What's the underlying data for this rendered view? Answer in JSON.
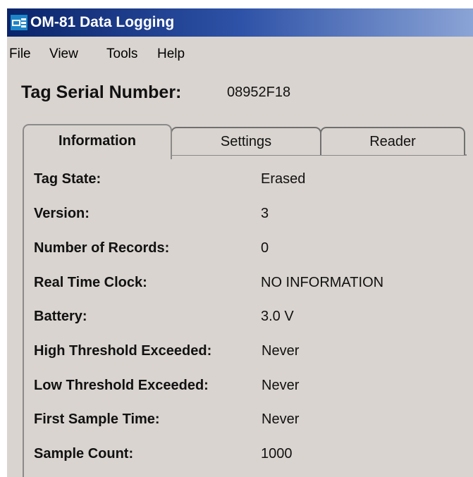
{
  "window": {
    "title": "OM-81 Data Logging",
    "icon": "app-icon"
  },
  "menu": [
    "File",
    "View",
    "Tools",
    "Help"
  ],
  "serial": {
    "label": "Tag Serial Number:",
    "value": "08952F18"
  },
  "tabs": [
    {
      "label": "Information",
      "active": true
    },
    {
      "label": "Settings",
      "active": false
    },
    {
      "label": "Reader",
      "active": false
    }
  ],
  "info_rows": [
    {
      "label": "Tag State:",
      "value": "Erased"
    },
    {
      "label": "Version:",
      "value": "3"
    },
    {
      "label": "Number of Records:",
      "value": "0"
    },
    {
      "label": "Real Time Clock:",
      "value": "NO INFORMATION"
    },
    {
      "label": "Battery:",
      "value": "3.0 V"
    },
    {
      "label": "High Threshold Exceeded:",
      "value": "Never"
    },
    {
      "label": "Low Threshold Exceeded:",
      "value": "Never"
    },
    {
      "label": "First Sample Time:",
      "value": "Never"
    },
    {
      "label": "Sample Count:",
      "value": "1000"
    }
  ],
  "colors": {
    "titlebar_start": "#0a246a",
    "titlebar_end": "#8ba4d6",
    "window_bg": "#d9d4cf"
  }
}
